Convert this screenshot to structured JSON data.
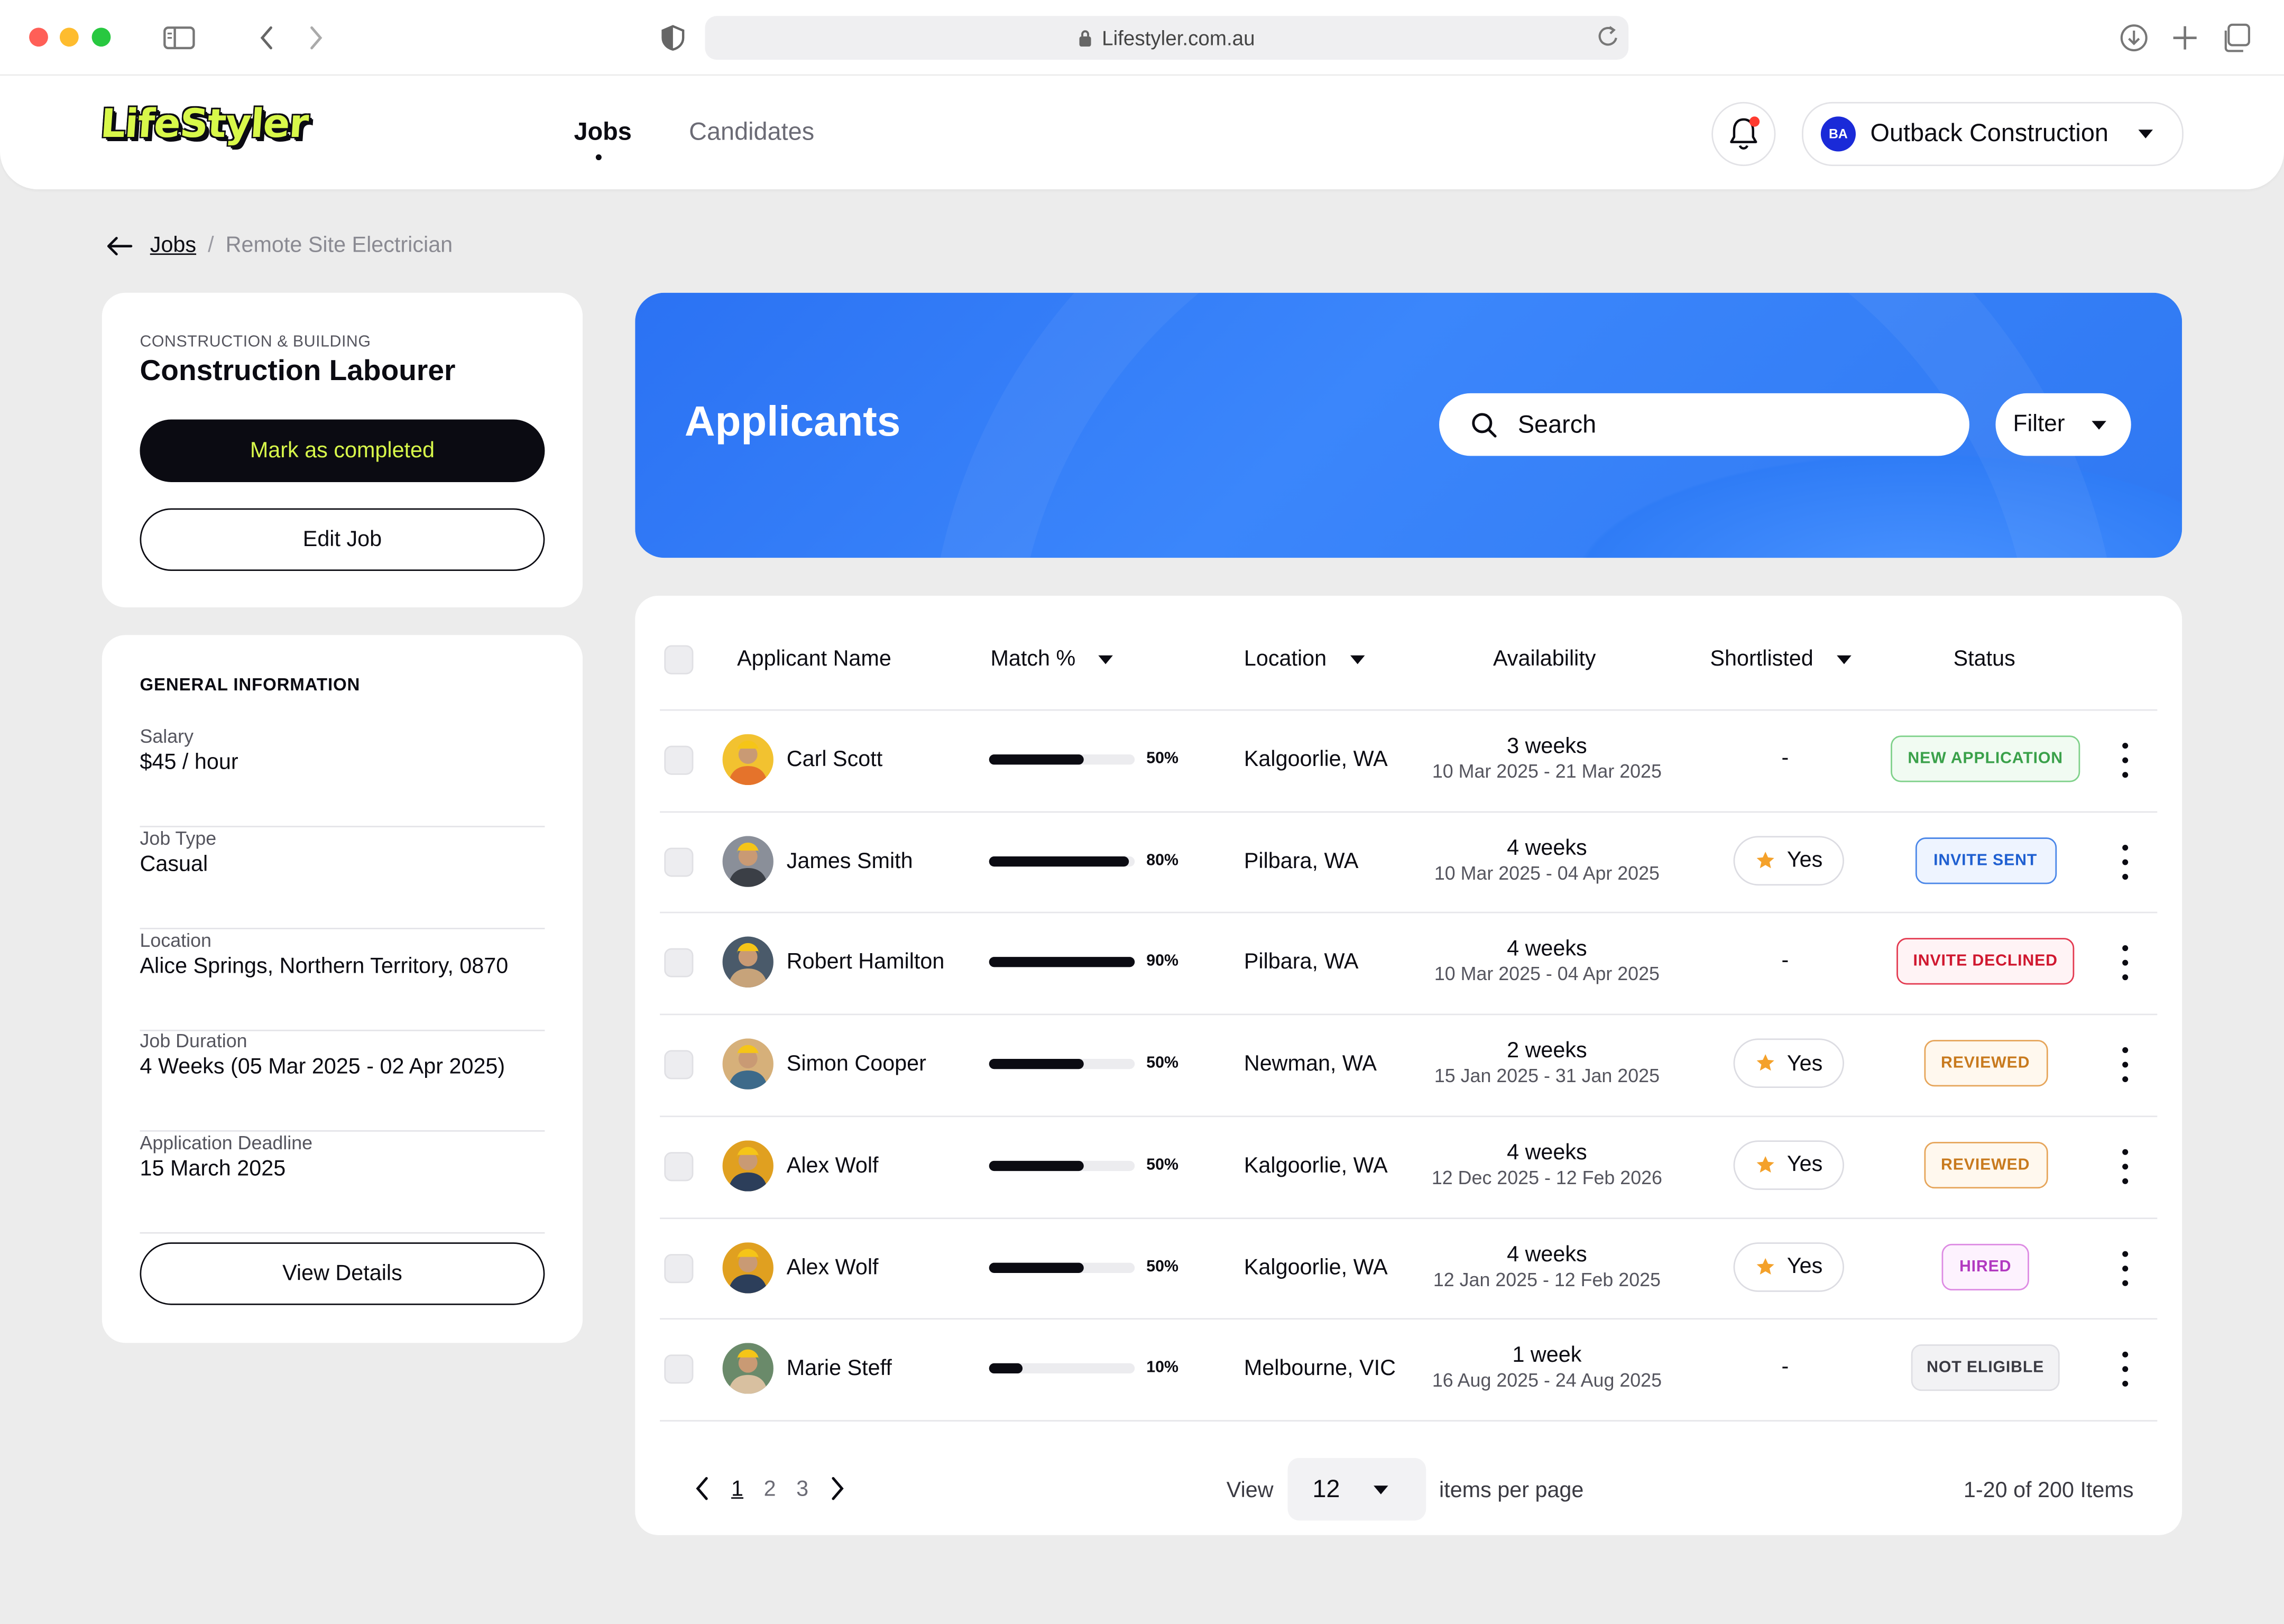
{
  "browser": {
    "url": "Lifestyler.com.au"
  },
  "header": {
    "logo": "LifeStyler",
    "nav": [
      "Jobs",
      "Candidates"
    ],
    "org_name": "Outback Construction",
    "org_initials": "BA"
  },
  "breadcrumb": {
    "parent": "Jobs",
    "separator": "/",
    "current": "Remote Site Electrician"
  },
  "job_card": {
    "category": "CONSTRUCTION & BUILDING",
    "title": "Construction Labourer",
    "mark_completed": "Mark as completed",
    "edit_job": "Edit Job"
  },
  "info_card": {
    "heading": "GENERAL INFORMATION",
    "rows": [
      {
        "label": "Salary",
        "value": "$45 / hour"
      },
      {
        "label": "Job Type",
        "value": "Casual"
      },
      {
        "label": "Location",
        "value": "Alice Springs, Northern Territory, 0870"
      },
      {
        "label": "Job Duration",
        "value": "4 Weeks (05 Mar 2025 - 02 Apr 2025)"
      },
      {
        "label": "Application Deadline",
        "value": "15 March 2025"
      }
    ],
    "view_details": "View Details"
  },
  "applicants": {
    "title": "Applicants",
    "search_placeholder": "Search",
    "filter_label": "Filter",
    "columns": {
      "name": "Applicant Name",
      "match": "Match %",
      "location": "Location",
      "availability": "Availability",
      "shortlisted": "Shortlisted",
      "status": "Status"
    },
    "rows": [
      {
        "name": "Carl Scott",
        "match": 50,
        "match_label": "50%",
        "location": "Kalgoorlie, WA",
        "weeks": "3 weeks",
        "dates": "10 Mar 2025 - 21 Mar 2025",
        "shortlisted": "-",
        "status": "NEW APPLICATION"
      },
      {
        "name": "James Smith",
        "match": 80,
        "match_label": "80%",
        "location": "Pilbara, WA",
        "weeks": "4 weeks",
        "dates": "10 Mar 2025 - 04 Apr 2025",
        "shortlisted": "Yes",
        "status": "INVITE SENT"
      },
      {
        "name": "Robert Hamilton",
        "match": 90,
        "match_label": "90%",
        "location": "Pilbara, WA",
        "weeks": "4 weeks",
        "dates": "10 Mar 2025 - 04 Apr 2025",
        "shortlisted": "-",
        "status": "INVITE DECLINED"
      },
      {
        "name": "Simon Cooper",
        "match": 50,
        "match_label": "50%",
        "location": "Newman, WA",
        "weeks": "2 weeks",
        "dates": "15 Jan 2025 - 31 Jan 2025",
        "shortlisted": "Yes",
        "status": "REVIEWED"
      },
      {
        "name": "Alex Wolf",
        "match": 50,
        "match_label": "50%",
        "location": "Kalgoorlie, WA",
        "weeks": "4 weeks",
        "dates": "12 Dec 2025 - 12 Feb 2026",
        "shortlisted": "Yes",
        "status": "REVIEWED"
      },
      {
        "name": "Alex Wolf",
        "match": 50,
        "match_label": "50%",
        "location": "Kalgoorlie, WA",
        "weeks": "4 weeks",
        "dates": "12 Jan 2025 - 12 Feb 2025",
        "shortlisted": "Yes",
        "status": "HIRED"
      },
      {
        "name": "Marie Steff",
        "match": 10,
        "match_label": "10%",
        "location": "Melbourne, VIC",
        "weeks": "1 week",
        "dates": "16 Aug 2025 - 24 Aug 2025",
        "shortlisted": "-",
        "status": "NOT ELIGIBLE"
      }
    ],
    "status_colors": {
      "NEW APPLICATION": {
        "text": "#3aa14a",
        "border": "#7fd18a",
        "bg": "#f1fbf2"
      },
      "INVITE SENT": {
        "text": "#1f5fd1",
        "border": "#4a86e8",
        "bg": "#eef4ff"
      },
      "INVITE DECLINED": {
        "text": "#d0172f",
        "border": "#e33a50",
        "bg": "#fff3f5"
      },
      "REVIEWED": {
        "text": "#c87a1e",
        "border": "#e6a55a",
        "bg": "#fff8ee"
      },
      "HIRED": {
        "text": "#b239c0",
        "border": "#dd8ae3",
        "bg": "#fdf2fe"
      },
      "NOT ELIGIBLE": {
        "text": "#3a3a42",
        "border": "#dedee3",
        "bg": "#f2f2f4"
      }
    }
  },
  "pagination": {
    "pages": [
      "1",
      "2",
      "3"
    ],
    "view_label": "View",
    "per_page": "12",
    "items_per_page": "items per page",
    "range": "1-20 of 200 Items"
  }
}
